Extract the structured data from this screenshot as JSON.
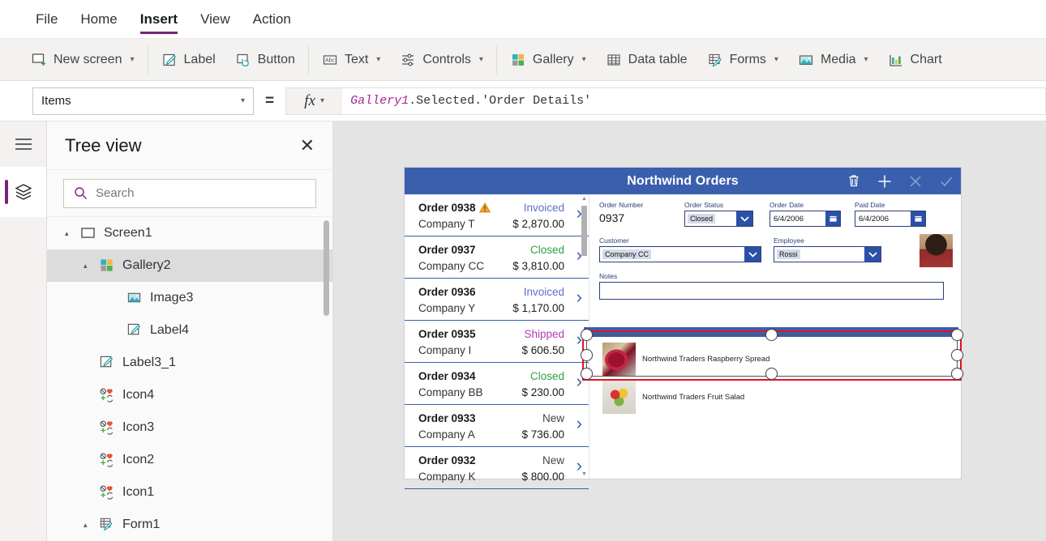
{
  "menu": {
    "items": [
      {
        "label": "File",
        "active": false
      },
      {
        "label": "Home",
        "active": false
      },
      {
        "label": "Insert",
        "active": true
      },
      {
        "label": "View",
        "active": false
      },
      {
        "label": "Action",
        "active": false
      }
    ]
  },
  "ribbon": {
    "items": [
      {
        "label": "New screen",
        "icon": "new-screen-icon",
        "caret": true
      },
      {
        "label": "Label",
        "icon": "label-icon",
        "caret": false
      },
      {
        "label": "Button",
        "icon": "button-icon",
        "caret": false
      },
      {
        "label": "Text",
        "icon": "text-icon",
        "caret": true
      },
      {
        "label": "Controls",
        "icon": "controls-icon",
        "caret": true
      },
      {
        "label": "Gallery",
        "icon": "gallery-icon",
        "caret": true
      },
      {
        "label": "Data table",
        "icon": "data-table-icon",
        "caret": false
      },
      {
        "label": "Forms",
        "icon": "forms-icon",
        "caret": true
      },
      {
        "label": "Media",
        "icon": "media-icon",
        "caret": true
      },
      {
        "label": "Chart",
        "icon": "chart-icon",
        "caret": false
      }
    ]
  },
  "formula_bar": {
    "property": "Items",
    "equals": "=",
    "fx_label": "fx",
    "formula_object": "Gallery1",
    "formula_rest": ".Selected.'Order Details'"
  },
  "tree_panel": {
    "title": "Tree view",
    "close_label": "✕",
    "search_placeholder": "Search",
    "nodes": [
      {
        "label": "Screen1",
        "icon": "screen-icon",
        "indent": 0,
        "expander": "▴",
        "selected": false
      },
      {
        "label": "Gallery2",
        "icon": "gallery-icon",
        "indent": 1,
        "expander": "▴",
        "selected": true
      },
      {
        "label": "Image3",
        "icon": "image-icon",
        "indent": 2,
        "expander": "",
        "selected": false
      },
      {
        "label": "Label4",
        "icon": "label-icon",
        "indent": 2,
        "expander": "",
        "selected": false
      },
      {
        "label": "Label3_1",
        "icon": "label-icon",
        "indent": 1,
        "expander": "",
        "selected": false
      },
      {
        "label": "Icon4",
        "icon": "icon-icon",
        "indent": 1,
        "expander": "",
        "selected": false
      },
      {
        "label": "Icon3",
        "icon": "icon-icon",
        "indent": 1,
        "expander": "",
        "selected": false
      },
      {
        "label": "Icon2",
        "icon": "icon-icon",
        "indent": 1,
        "expander": "",
        "selected": false
      },
      {
        "label": "Icon1",
        "icon": "icon-icon",
        "indent": 1,
        "expander": "",
        "selected": false
      },
      {
        "label": "Form1",
        "icon": "form-icon",
        "indent": 0,
        "expander": "▴",
        "selected": false
      }
    ]
  },
  "app": {
    "header": {
      "title": "Northwind Orders",
      "icons": [
        {
          "name": "trash-icon",
          "enabled": true
        },
        {
          "name": "plus-icon",
          "enabled": true
        },
        {
          "name": "cancel-icon",
          "enabled": false
        },
        {
          "name": "check-icon",
          "enabled": false
        }
      ]
    },
    "order_gallery": {
      "rows": [
        {
          "order": "Order 0938",
          "company": "Company T",
          "status": "Invoiced",
          "status_color": "#5b6fcc",
          "amount": "$ 2,870.00",
          "warning": true
        },
        {
          "order": "Order 0937",
          "company": "Company CC",
          "status": "Closed",
          "status_color": "#2ea043",
          "amount": "$ 3,810.00",
          "warning": false
        },
        {
          "order": "Order 0936",
          "company": "Company Y",
          "status": "Invoiced",
          "status_color": "#5b6fcc",
          "amount": "$ 1,170.00",
          "warning": false
        },
        {
          "order": "Order 0935",
          "company": "Company I",
          "status": "Shipped",
          "status_color": "#b43cb4",
          "amount": "$ 606.50",
          "warning": false
        },
        {
          "order": "Order 0934",
          "company": "Company BB",
          "status": "Closed",
          "status_color": "#2ea043",
          "amount": "$ 230.00",
          "warning": false
        },
        {
          "order": "Order 0933",
          "company": "Company A",
          "status": "New",
          "status_color": "#444444",
          "amount": "$ 736.00",
          "warning": false
        },
        {
          "order": "Order 0932",
          "company": "Company K",
          "status": "New",
          "status_color": "#444444",
          "amount": "$ 800.00",
          "warning": false
        }
      ]
    },
    "detail_form": {
      "order_number_label": "Order Number",
      "order_number_value": "0937",
      "order_status_label": "Order Status",
      "order_status_value": "Closed",
      "order_date_label": "Order Date",
      "order_date_value": "6/4/2006",
      "paid_date_label": "Paid Date",
      "paid_date_value": "6/4/2006",
      "customer_label": "Customer",
      "customer_value": "Company CC",
      "employee_label": "Employee",
      "employee_value": "Rossi",
      "notes_label": "Notes",
      "notes_value": ""
    },
    "product_gallery": {
      "rows": [
        {
          "name": "Northwind Traders Raspberry Spread",
          "thumb": "rasp",
          "selected": true
        },
        {
          "name": "Northwind Traders Fruit Salad",
          "thumb": "salad",
          "selected": false
        }
      ]
    }
  },
  "colors": {
    "accent_purple": "#742774",
    "app_blue": "#3a5fad",
    "selection_red": "#e81123",
    "ribbon_bg": "#f3f2f1",
    "canvas_bg": "#e4e4e4"
  }
}
